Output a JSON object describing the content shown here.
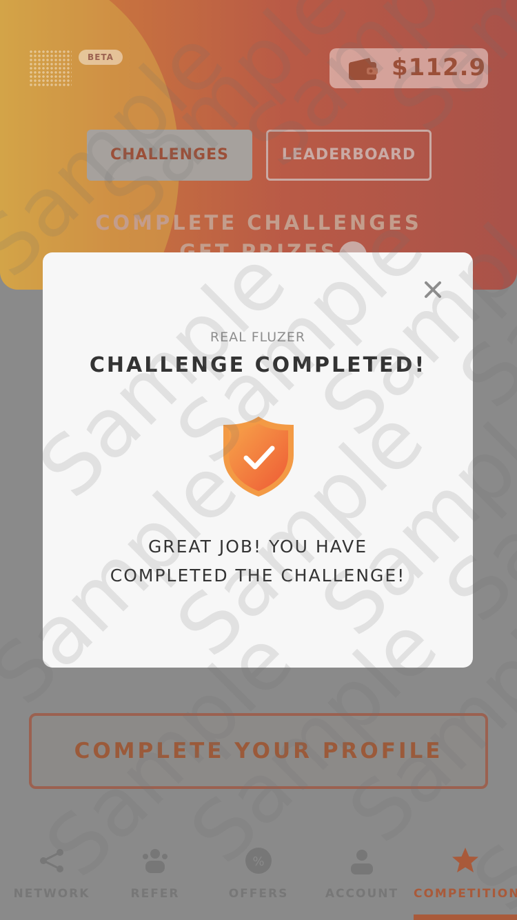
{
  "header": {
    "beta_label": "BETA",
    "wallet_amount": "$112.9"
  },
  "tabs": [
    {
      "label": "CHALLENGES",
      "active": true
    },
    {
      "label": "LEADERBOARD",
      "active": false
    }
  ],
  "hero": {
    "title": "COMPLETE CHALLENGES",
    "subtitle": "GET PRIZES"
  },
  "profile_button": {
    "label": "COMPLETE YOUR PROFILE"
  },
  "bottom_nav": [
    {
      "label": "NETWORK",
      "icon": "network-icon"
    },
    {
      "label": "REFER",
      "icon": "refer-icon"
    },
    {
      "label": "OFFERS",
      "icon": "offers-icon"
    },
    {
      "label": "ACCOUNT",
      "icon": "account-icon"
    },
    {
      "label": "COMPETITION",
      "icon": "star-icon",
      "active": true
    }
  ],
  "modal": {
    "subtitle": "REAL FLUZER",
    "title": "CHALLENGE COMPLETED!",
    "message_line1": "GREAT JOB! YOU HAVE",
    "message_line2": "COMPLETED THE CHALLENGE!",
    "close_symbol": "×"
  },
  "watermark": {
    "text": "Sample"
  },
  "colors": {
    "accent": "#F26B3A",
    "accent_light": "#F7A44A",
    "modal_bg": "#F7F7F7",
    "overlay": "#8A8A8A"
  }
}
